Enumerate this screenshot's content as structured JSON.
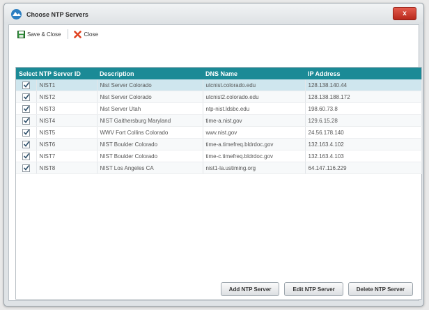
{
  "window": {
    "title": "Choose NTP Servers",
    "close_label": "x"
  },
  "toolbar": {
    "save_close_label": "Save & Close",
    "close_label": "Close"
  },
  "table": {
    "columns": [
      "Select",
      "NTP Server ID",
      "Description",
      "DNS Name",
      "IP Address"
    ],
    "rows": [
      {
        "checked": true,
        "id": "NIST1",
        "description": "Nist Server Colorado",
        "dns": "utcnist.colorado.edu",
        "ip": "128.138.140.44"
      },
      {
        "checked": true,
        "id": "NIST2",
        "description": "Nist Server Colorado",
        "dns": "utcnist2.colorado.edu",
        "ip": "128.138.188.172"
      },
      {
        "checked": true,
        "id": "NIST3",
        "description": "Nist Server Utah",
        "dns": "ntp-nist.ldsbc.edu",
        "ip": "198.60.73.8"
      },
      {
        "checked": true,
        "id": "NIST4",
        "description": "NIST Gaithersburg Maryland",
        "dns": "time-a.nist.gov",
        "ip": "129.6.15.28"
      },
      {
        "checked": true,
        "id": "NIST5",
        "description": "WWV Fort Collins Colorado",
        "dns": "wwv.nist.gov",
        "ip": "24.56.178.140"
      },
      {
        "checked": true,
        "id": "NIST6",
        "description": "NIST Boulder Colorado",
        "dns": "time-a.timefreq.bldrdoc.gov",
        "ip": "132.163.4.102"
      },
      {
        "checked": true,
        "id": "NIST7",
        "description": "NIST Boulder Colorado",
        "dns": "time-c.timefreq.bldrdoc.gov",
        "ip": "132.163.4.103"
      },
      {
        "checked": true,
        "id": "NIST8",
        "description": "NIST Los Angeles CA",
        "dns": "nist1-la.ustiming.org",
        "ip": "64.147.116.229"
      }
    ]
  },
  "buttons": {
    "add": "Add NTP Server",
    "edit": "Edit NTP Server",
    "delete": "Delete NTP Server"
  },
  "colors": {
    "header": "#1b8a96",
    "selected_row": "#cfe6ee",
    "close_button": "#c9372a"
  }
}
